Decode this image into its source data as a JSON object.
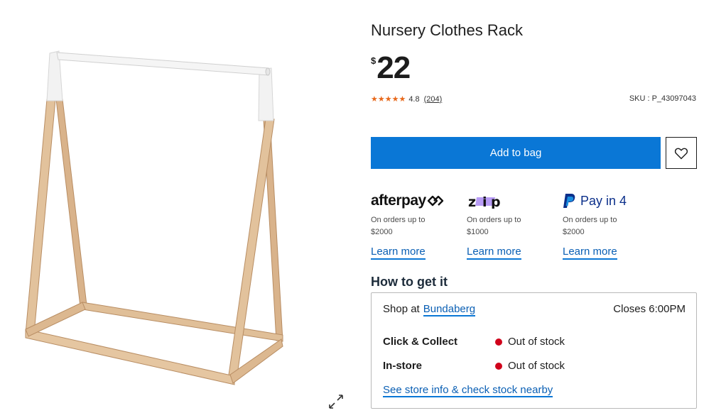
{
  "product": {
    "title": "Nursery Clothes Rack",
    "currency": "$",
    "price": "22",
    "rating": "4.8",
    "rating_stars": 5,
    "review_count": "(204)",
    "sku": "SKU : P_43097043"
  },
  "actions": {
    "add_to_bag": "Add to bag"
  },
  "payments": [
    {
      "name": "afterpay",
      "subtitle": "On orders up to $2000",
      "learn": "Learn more"
    },
    {
      "name": "zip",
      "subtitle": "On orders up to $1000",
      "learn": "Learn more"
    },
    {
      "name": "Pay in 4",
      "subtitle": "On orders up to $2000",
      "learn": "Learn more"
    }
  ],
  "fulfilment": {
    "heading": "How to get it",
    "shop_at": "Shop at",
    "store": "Bundaberg",
    "closes": "Closes 6:00PM",
    "options": [
      {
        "label": "Click & Collect",
        "status": "Out of stock"
      },
      {
        "label": "In-store",
        "status": "Out of stock"
      }
    ],
    "see_info": "See store info & check stock nearby"
  },
  "colors": {
    "accent": "#0a77d6",
    "star": "#e8691c",
    "out_of_stock": "#d0021b"
  },
  "icons": [
    "heart-icon",
    "expand-icon",
    "star-icon"
  ]
}
